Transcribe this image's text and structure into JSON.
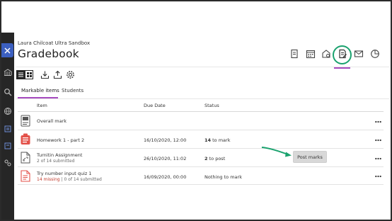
{
  "course_name": "Laura Chilcoat Ultra Sandbox",
  "page_title": "Gradebook",
  "tabs": [
    {
      "label": "Markable items",
      "active": true
    },
    {
      "label": "Students",
      "active": false
    }
  ],
  "columns": {
    "item": "Item",
    "due_date": "Due Date",
    "status": "Status"
  },
  "rows": [
    {
      "icon": "overall-mark-icon",
      "title": "Overall mark",
      "subtitle": "",
      "missing": "",
      "due": "",
      "status_bold": "",
      "status_text": ""
    },
    {
      "icon": "assignment-icon",
      "title": "Homework 1 - part 2",
      "subtitle": "",
      "missing": "",
      "due": "16/10/2020, 12:00",
      "status_bold": "14",
      "status_text": "to mark"
    },
    {
      "icon": "turnitin-icon",
      "title": "Turnitin Assignment",
      "subtitle": "2 of 14 submitted",
      "missing": "",
      "due": "26/10/2020, 11:02",
      "status_bold": "2",
      "status_text": "to post"
    },
    {
      "icon": "test-icon",
      "title": "Try number input quiz 1",
      "subtitle": "| 0 of 14 submitted",
      "missing": "14 missing",
      "due": "16/09/2020, 00:00",
      "status_bold": "",
      "status_text": "Nothing to mark"
    }
  ],
  "post_marks_label": "Post marks",
  "colors": {
    "accent_purple": "#a64bbf",
    "highlight_green": "#1aa26e",
    "missing_red": "#c0392b",
    "close_blue": "#3b5fc0"
  },
  "tools": [
    "gradebook-icon",
    "calendar-icon",
    "performance-icon",
    "gradebook-active-icon",
    "messages-icon",
    "analytics-icon"
  ]
}
